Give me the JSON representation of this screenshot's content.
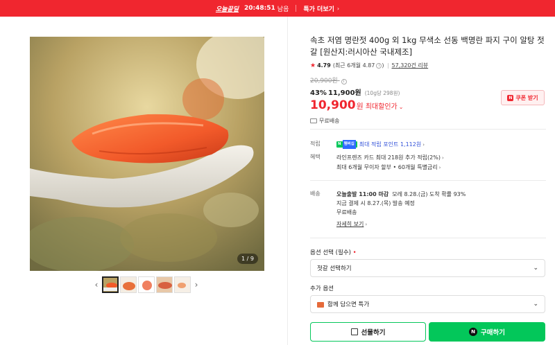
{
  "topbar": {
    "badge": "오늘끝딜",
    "timer": "20:48:51",
    "timer_suffix": "남음",
    "more": "특가 더보기",
    "bg_color": "#f0262f"
  },
  "gallery": {
    "counter": "1 / 9",
    "thumb_count": 5
  },
  "product": {
    "title": "속초 저염 명란젓 400g 외 1kg 무색소 선동 백명란 파지 구이 알탕 젓갈 [원산지:러시아산 국내제조]",
    "rating": "4.79",
    "rating_recent": "(최근 6개월 4.87",
    "rating_recent_close": ")",
    "reviews": "57,320건 리뷰",
    "original_price": "20,900원",
    "discount_rate": "43%",
    "discount_price": "11,900원",
    "unit_price": "(10g당 298원)",
    "final_price": "10,900",
    "final_won": "원",
    "final_label": "최대할인가",
    "shipping_free": "무료배송",
    "coupon": "쿠폰 받기"
  },
  "benefits": {
    "point_label": "적립",
    "npay": "N",
    "plus": "멤버십",
    "point_text": "최대 적립 포인트 1,112원",
    "benefit_label": "혜택",
    "benefit_line1": "라인프렌즈 카드 최대 218원 추가 적립(2%)",
    "benefit_line2": "최대 6개월 무이자 할부 • 60개월 특별금리"
  },
  "delivery": {
    "label": "배송",
    "line1_bold": "오늘출발 11:00 마감",
    "line1_rest": "  모레 8.28.(금) 도착 확률 93%",
    "line2": "지금 결제 시 8.27.(목) 발송 예정",
    "line3": "무료배송",
    "detail": "자세히 보기"
  },
  "options": {
    "select_label": "옵션 선택 (필수)",
    "required_mark": "•",
    "select_value": "젓갈 선택하기",
    "extra_label": "추가 옵션",
    "extra_value": "함께 담으면 특가"
  },
  "actions": {
    "gift": "선물하기",
    "buy": "구매하기",
    "buy_color": "#03c75a"
  },
  "icons": [
    "star-icon",
    "info-icon",
    "truck-icon",
    "chevron-down-icon",
    "gift-icon",
    "naver-n-icon",
    "coupon-icon"
  ]
}
